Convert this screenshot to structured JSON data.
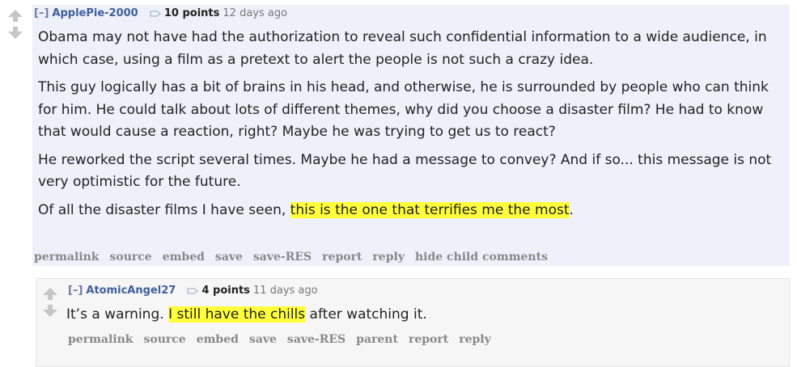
{
  "comments": [
    {
      "expand": "[–]",
      "author": "ApplePie-2000",
      "points": "10 points",
      "time": "12 days ago",
      "paragraphs": [
        "Obama may not have had the authorization to reveal such confidential information to a wide audience, in which case, using a film as a pretext to alert the people is not such a crazy idea.",
        "This guy logically has a bit of brains in his head, and otherwise, he is surrounded by people who can think for him. He could talk about lots of different themes, why did you choose a disaster film? He had to know that would cause a reaction, right? Maybe he was trying to get us to react?",
        "He reworked the script several times. Maybe he had a message to convey? And if so... this message is not very optimistic for the future."
      ],
      "last": {
        "before": "Of all the disaster films I have seen, ",
        "highlight": "this is the one that terrifies me the most",
        "after": "."
      },
      "buttons": [
        "permalink",
        "source",
        "embed",
        "save",
        "save-RES",
        "report",
        "reply",
        "hide child comments"
      ]
    },
    {
      "expand": "[–]",
      "author": "AtomicAngel27",
      "points": "4 points",
      "time": "11 days ago",
      "text": {
        "before": "It’s a warning. ",
        "highlight": "I still have the chills",
        "after": " after watching it."
      },
      "buttons": [
        "permalink",
        "source",
        "embed",
        "save",
        "save-RES",
        "parent",
        "report",
        "reply"
      ]
    }
  ],
  "colors": {
    "highlight": "#ffff3c",
    "author": "#3f5f9a",
    "comment_bg": "#eef1f9",
    "child_bg": "#f6f6f6"
  }
}
